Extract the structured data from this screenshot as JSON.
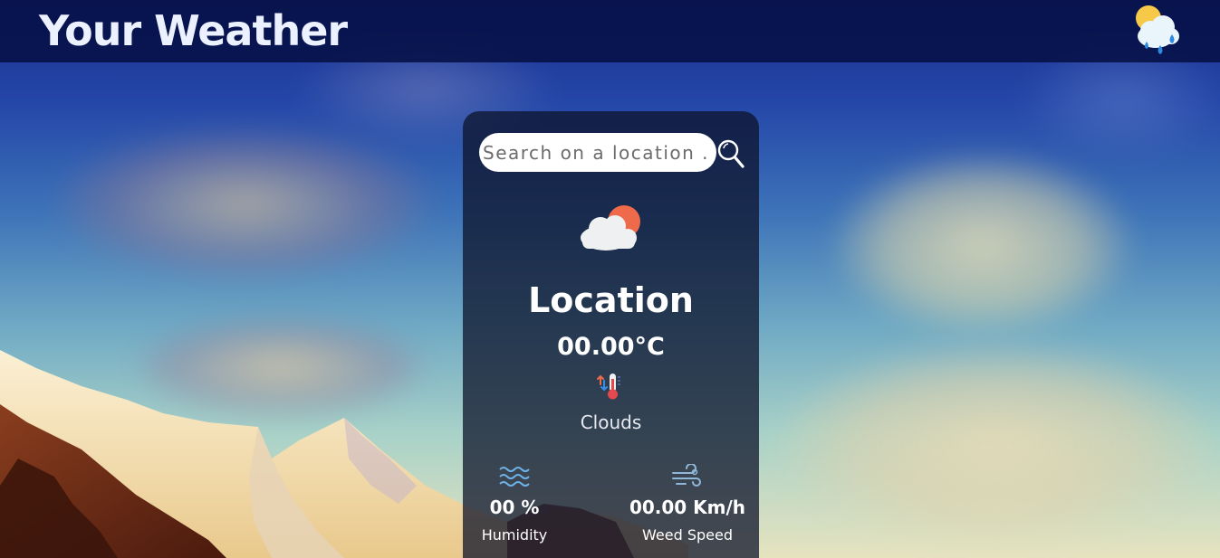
{
  "header": {
    "title": "Your Weather",
    "logo_icon": "sun-cloud-rain-icon"
  },
  "search": {
    "placeholder": "Search on a location ..",
    "value": "",
    "button_icon": "search-icon"
  },
  "weather": {
    "icon": "cloud-sun-icon",
    "location": "Location",
    "temperature": "00.00°C",
    "temperature_icon": "thermometer-icon",
    "condition": "Clouds"
  },
  "stats": {
    "humidity": {
      "icon": "waves-icon",
      "value": "00 %",
      "label": "Humidity"
    },
    "wind": {
      "icon": "wind-icon",
      "value": "00.00 Km/h",
      "label": "Weed Speed"
    }
  },
  "colors": {
    "header_bg": "#06104a",
    "card_bg": "#0c1228",
    "text": "#ffffff",
    "sun_accent": "#ee6a4a",
    "rain_drop": "#2e8ae0"
  }
}
